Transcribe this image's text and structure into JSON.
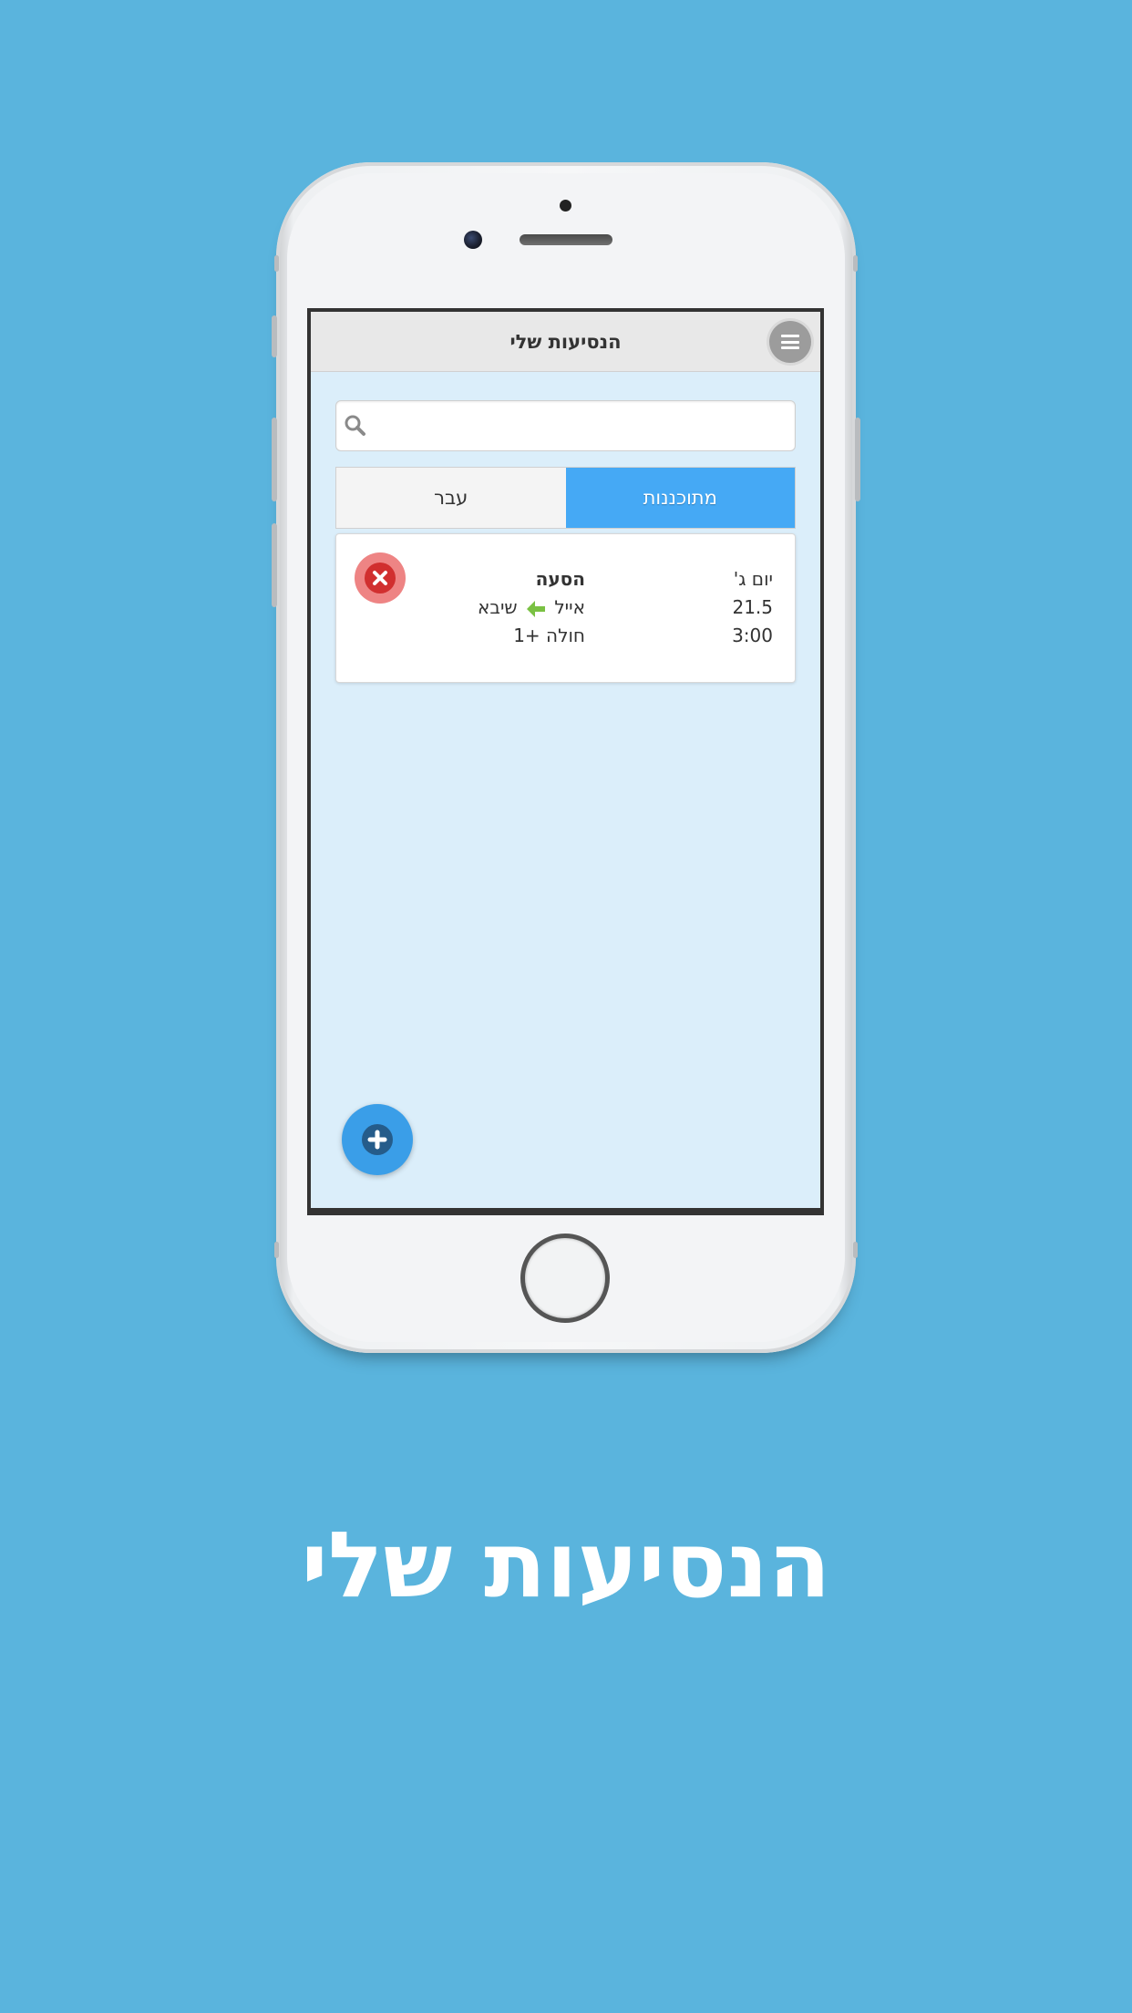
{
  "app": {
    "title": "הנסיעות שלי"
  },
  "search": {
    "placeholder": "",
    "value": ""
  },
  "tabs": [
    {
      "label": "מתוכננות",
      "active": true
    },
    {
      "label": "עבר",
      "active": false
    }
  ],
  "trips": [
    {
      "day": "יום ג'",
      "date": "21.5",
      "time": "3:00",
      "type": "הסעה",
      "from": "אייל",
      "to": "שיבא",
      "passengers": "חולה +1"
    }
  ],
  "promo": {
    "title": "הנסיעות שלי"
  },
  "colors": {
    "background": "#5ab4dd",
    "active_tab": "#45a9f5",
    "delete": "#d12f2f",
    "add": "#3a9ee8",
    "arrow": "#7ac143"
  },
  "icons": {
    "menu": "hamburger-icon",
    "search": "search-icon",
    "delete": "close-circle-icon",
    "add": "plus-circle-icon",
    "direction": "arrow-left-icon"
  }
}
